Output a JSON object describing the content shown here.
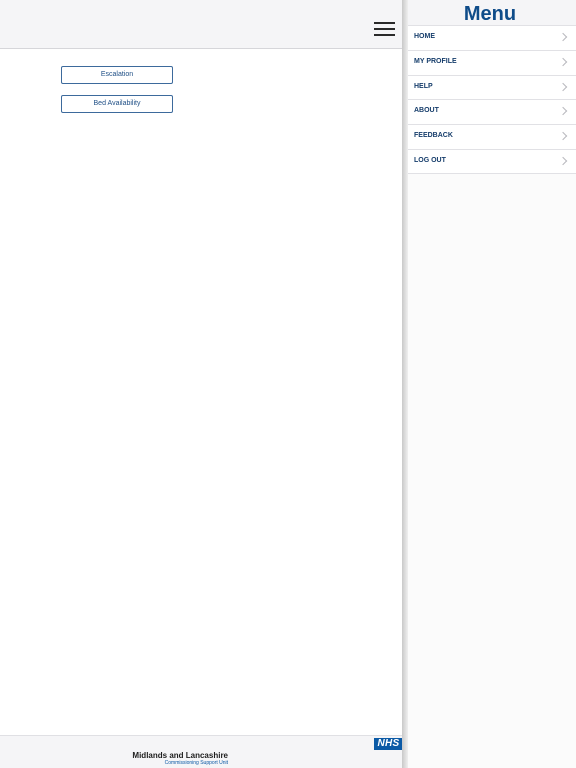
{
  "main": {
    "buttons": [
      {
        "label": "Escalation"
      },
      {
        "label": "Bed Availability"
      }
    ]
  },
  "footer": {
    "nhs_logo": "NHS",
    "org_name": "Midlands and Lancashire",
    "org_sub": "Commissioning Support Unit"
  },
  "menu": {
    "title": "Menu",
    "items": [
      {
        "label": "HOME"
      },
      {
        "label": "MY PROFILE"
      },
      {
        "label": "HELP"
      },
      {
        "label": "ABOUT"
      },
      {
        "label": "FEEDBACK"
      },
      {
        "label": "LOG OUT"
      }
    ]
  },
  "icons": {
    "menu_toggle": "hamburger-icon",
    "item_arrow": "chevron-right-icon"
  },
  "colors": {
    "brand_blue": "#0f4c89",
    "nhs_blue": "#0b5aa6",
    "button_border": "#3d6a9c"
  }
}
